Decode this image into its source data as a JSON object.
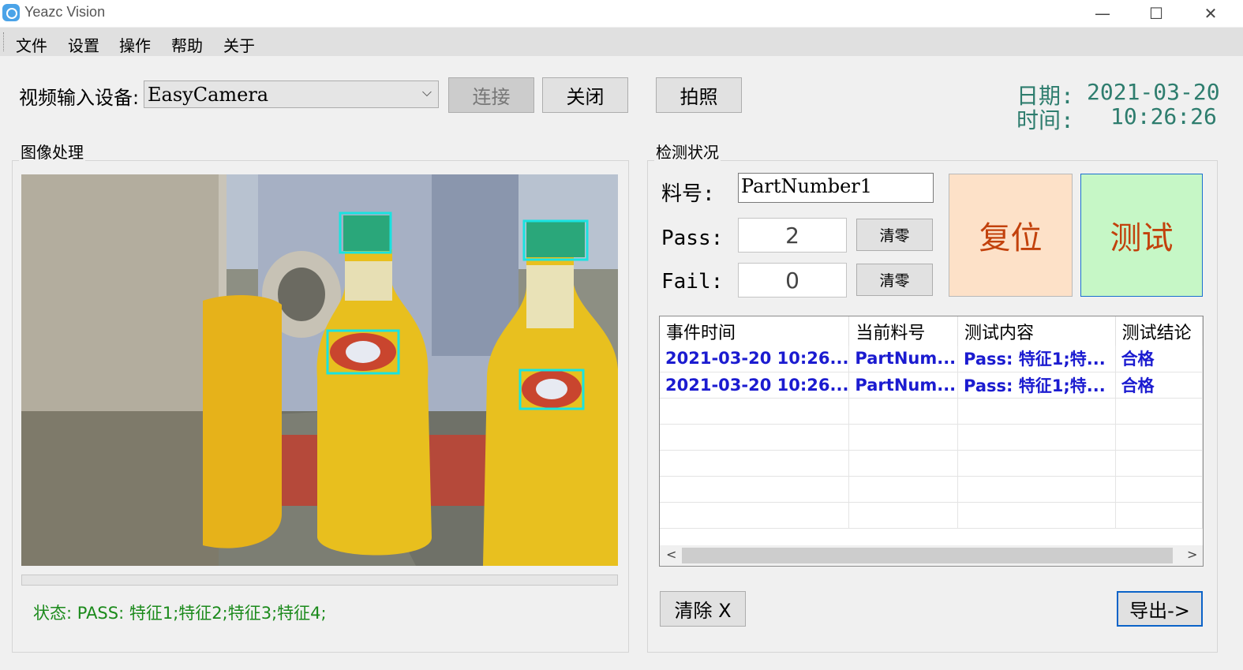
{
  "window": {
    "title": "Yeazc Vision",
    "minimize": "—",
    "maximize": "☐",
    "close": "✕"
  },
  "menu": [
    "文件",
    "设置",
    "操作",
    "帮助",
    "关于"
  ],
  "video": {
    "label": "视频输入设备:",
    "device": "EasyCamera",
    "connect": "连接",
    "close": "关闭",
    "photo": "拍照"
  },
  "datetime": {
    "date_label": "日期:",
    "date": "2021-03-20",
    "time_label": "时间:",
    "time": "10:26:26"
  },
  "image_panel": {
    "title": "图像处理",
    "status": "状态: PASS: 特征1;特征2;特征3;特征4;"
  },
  "detection": {
    "title": "检测状况",
    "part_label": "料号:",
    "part_value": "PartNumber1",
    "pass_label": "Pass:",
    "pass_count": "2",
    "fail_label": "Fail:",
    "fail_count": "0",
    "zero_label": "清零",
    "reset_label": "复位",
    "test_label": "测试",
    "clear_label": "清除 X",
    "export_label": "导出->"
  },
  "grid": {
    "columns": [
      "事件时间",
      "当前料号",
      "测试内容",
      "测试结论"
    ],
    "rows": [
      [
        "2021-03-20  10:26...",
        "PartNum...",
        "Pass: 特征1;特...",
        "合格"
      ],
      [
        "2021-03-20  10:26...",
        "PartNum...",
        "Pass: 特征1;特...",
        "合格"
      ]
    ]
  },
  "colors": {
    "accent_green": "#1b8a1b",
    "datetime": "#2e7d6e",
    "grid_text": "#1b1bd0",
    "reset_bg": "#fde1c8",
    "test_bg": "#c6f7c6",
    "big_button_text": "#c2410c"
  }
}
